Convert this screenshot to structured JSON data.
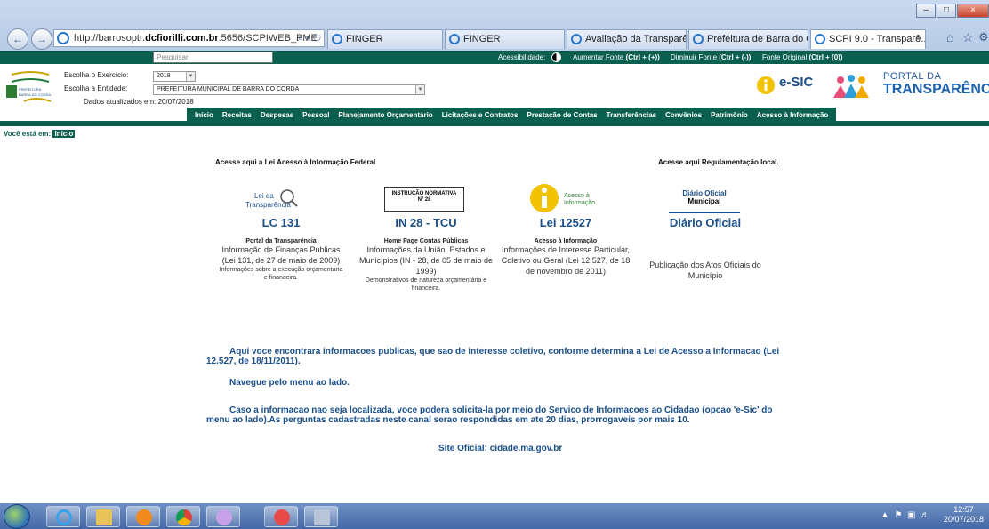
{
  "browser": {
    "url_prefix": "http://barrosoptr.",
    "url_domain": "dcfiorilli.com.br",
    "url_suffix": ":5656/SCPIWEB_PME",
    "tabs": [
      {
        "label": "FINGER"
      },
      {
        "label": "FINGER"
      },
      {
        "label": "Avaliação da Transparê..."
      },
      {
        "label": "Prefeitura de Barra do C..."
      },
      {
        "label": "SCPI 9.0 - Transparê...",
        "active": true
      }
    ]
  },
  "topbar": {
    "search_placeholder": "Pesquisar",
    "accessibility_label": "Acessibilidade:",
    "increase_label": "Aumentar Fonte",
    "increase_key": "(Ctrl + (+))",
    "decrease_label": "Diminuir Fonte",
    "decrease_key": "(Ctrl + (-))",
    "original_label": "Fonte Original",
    "original_key": "(Ctrl + (0))"
  },
  "header": {
    "exercise_label": "Escolha o Exercício:",
    "exercise_value": "2018",
    "entity_label": "Escolha a Entidade:",
    "entity_value": "PREFEITURA MUNICIPAL DE BARRA DO CORDA",
    "updated_label": "Dados atualizados em: 20/07/2018",
    "esic_label": "e-SIC",
    "portal_line1": "PORTAL DA",
    "portal_line2": "TRANSPARÊNCIA"
  },
  "menu": [
    "Início",
    "Receitas",
    "Despesas",
    "Pessoal",
    "Planejamento Orçamentário",
    "Licitações e Contratos",
    "Prestação de Contas",
    "Transferências",
    "Convênios",
    "Patrimônio",
    "Acesso à Informação"
  ],
  "breadcrumb": {
    "label": "Você está em:",
    "current": "Início"
  },
  "content": {
    "federal_heading": "Acesse aqui a Lei Acesso à Informação Federal",
    "local_heading": "Acesse aqui Regulamentação local.",
    "cards": [
      {
        "logo_text1": "Lei da",
        "logo_text2": "Transparência",
        "title": "LC 131",
        "subtitle": "Portal da Transparência",
        "desc": "Informação de Finanças Públicas (Lei 131, de 27 de maio de 2009)",
        "note": "Informações sobre a execução orçamentária e financeira."
      },
      {
        "logo_text1": "INSTRUÇÃO NORMATIVA",
        "logo_text2": "Nº 28",
        "title": "IN 28 - TCU",
        "subtitle": "Home Page Contas Públicas",
        "desc": "Informações da União, Estados e Municípios (IN - 28, de 05 de maio de 1999)",
        "note": "Demonstrativos de natureza orçamentária e financeira."
      },
      {
        "logo_text1": "Acesso à",
        "logo_text2": "Informação",
        "title": "Lei 12527",
        "subtitle": "Acesso à Informação",
        "desc": "Informações de Interesse Particular, Coletivo ou Geral (Lei 12.527, de 18 de novembro de 2011)",
        "note": ""
      },
      {
        "logo_text1": "Diário Oficial",
        "logo_text2": "Municipal",
        "title": "Diário Oficial",
        "subtitle": "",
        "desc": "Publicação dos Atos Oficiais do Município",
        "note": ""
      }
    ],
    "para1": "Aqui voce encontrara informacoes publicas, que sao de interesse coletivo, conforme determina a Lei de Acesso a Informacao (Lei 12.527, de 18/11/2011).",
    "para2": "Navegue pelo menu ao lado.",
    "para3": "Caso a informacao nao seja localizada, voce podera solicita-la por meio do Servico de Informacoes ao Cidadao (opcao 'e-Sic' do menu ao lado).As perguntas cadastradas neste canal serao respondidas em ate 20 dias, prorrogaveis por mais 10.",
    "site": "Site Oficial: cidade.ma.gov.br"
  },
  "taskbar": {
    "time": "12:57",
    "date": "20/07/2018",
    "icons": [
      "ie-icon",
      "explorer-icon",
      "media-player-icon",
      "chrome-icon",
      "paint-icon",
      "snipping-tool-icon",
      "calculator-icon"
    ]
  },
  "colors": {
    "site_green": "#0a5f4f",
    "link_blue": "#1a4f8a"
  }
}
